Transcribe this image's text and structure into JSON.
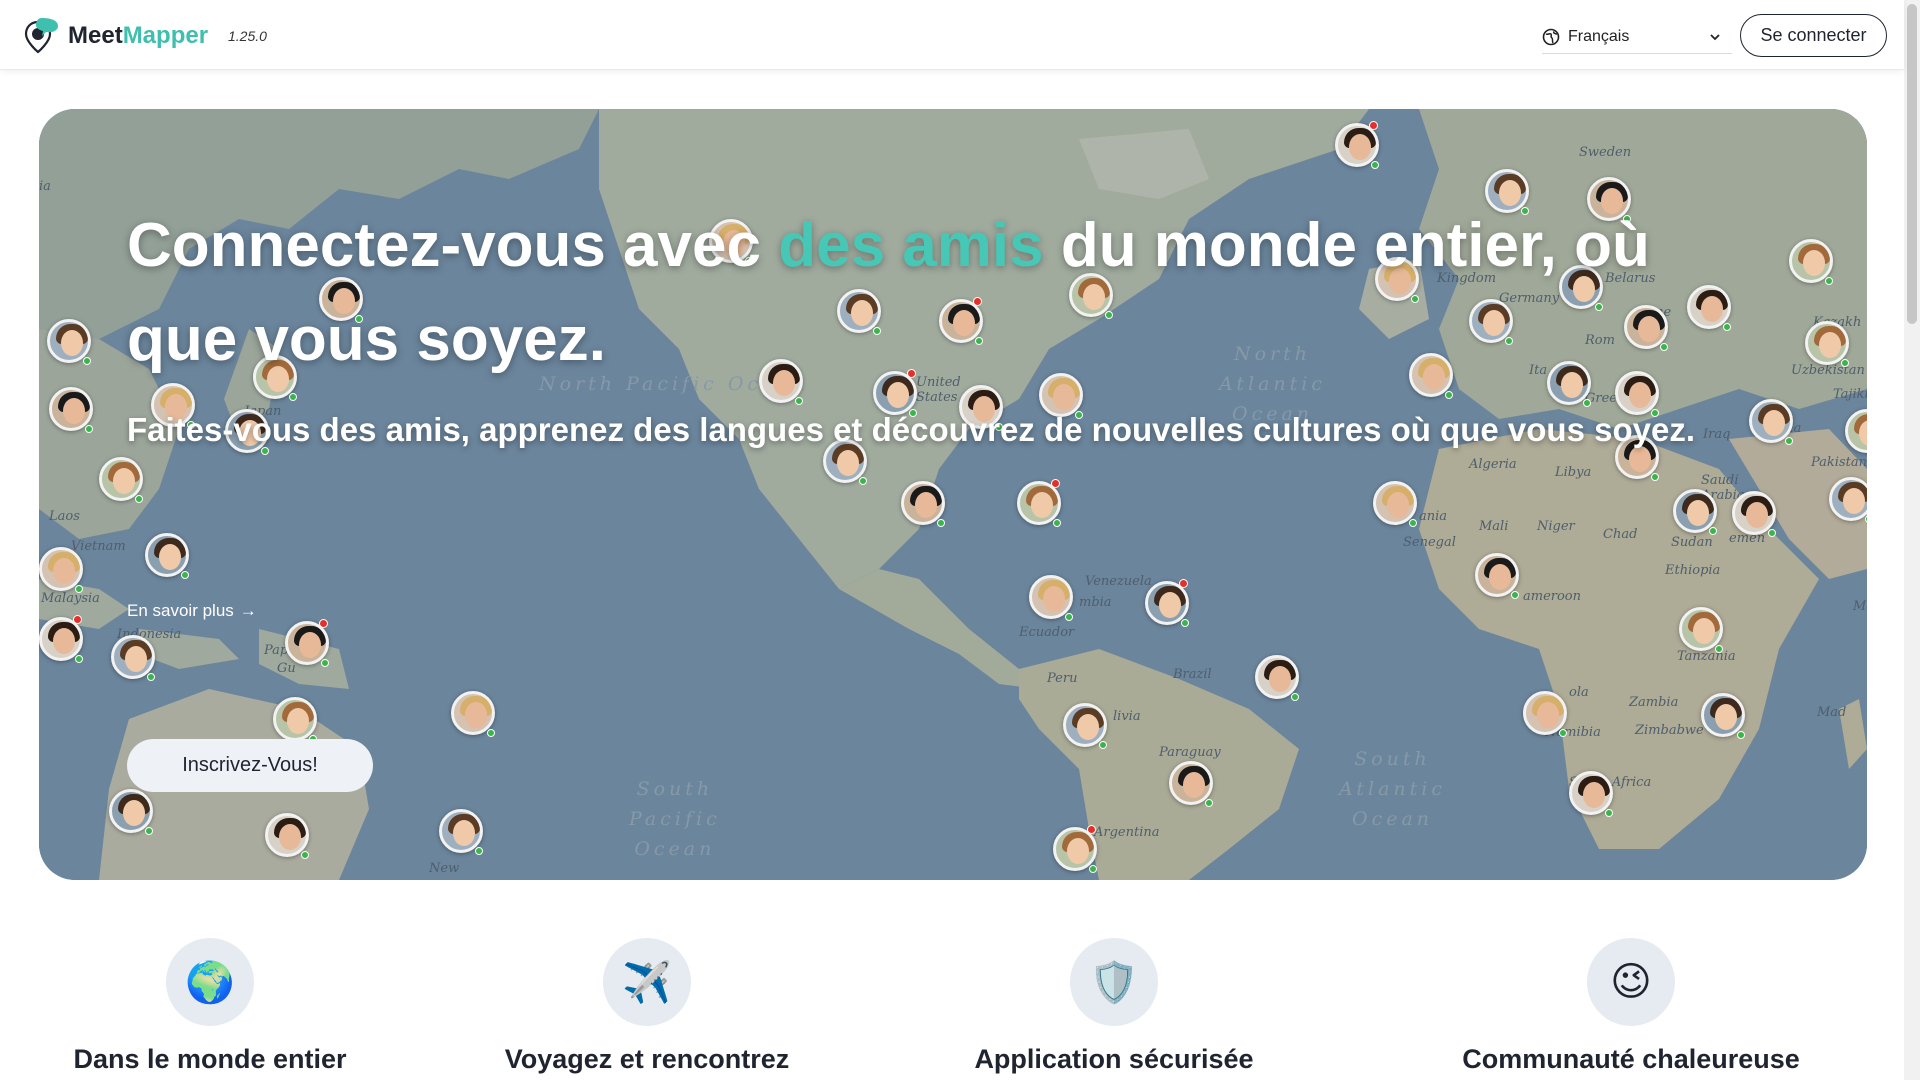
{
  "header": {
    "brand_part1": "Meet",
    "brand_part2": "Mapper",
    "version": "1.25.0",
    "language_selected": "Français",
    "login_label": "Se connecter"
  },
  "hero": {
    "title_before": "Connectez-vous avec ",
    "title_accent": "des amis",
    "title_after": " du monde entier, où que vous soyez.",
    "subtitle": "Faites-vous des amis, apprenez des langues et découvrez de nouvelles cultures où que vous soyez.",
    "learn_more_label": "En savoir plus",
    "signup_label": "Inscrivez-Vous!",
    "accent_color": "#47c7b6"
  },
  "map_labels": {
    "north_pacific": "North Pacific Ocean",
    "north_atlantic_1": "North",
    "north_atlantic_2": "Atlantic",
    "north_atlantic_3": "Ocean",
    "south_pacific_1": "South",
    "south_pacific_2": "Pacific",
    "south_pacific_3": "Ocean",
    "south_atlantic_1": "South",
    "south_atlantic_2": "Atlantic",
    "south_atlantic_3": "Ocean",
    "japan": "Japan",
    "laos": "Laos",
    "vietnam": "Vietnam",
    "malaysia": "Malaysia",
    "indonesia": "Indonesia",
    "papua": "Pap",
    "guinea": "Gu",
    "new": "New",
    "united_states_1": "United",
    "united_states_2": "States",
    "venezuela": "Venezuela",
    "colombia": "mbia",
    "ecuador": "Ecuador",
    "peru": "Peru",
    "brazil": "Brazil",
    "bolivia": "livia",
    "paraguay": "Paraguay",
    "argentina": "Argentina",
    "sweden": "Sweden",
    "kingdom": "Kingdom",
    "germany": "Germany",
    "belarus": "Belarus",
    "ukraine": "ine",
    "romania": "Rom",
    "italy": "Ita",
    "greece": "Greece",
    "algeria": "Algeria",
    "libya": "Libya",
    "mauritania": "ania",
    "mali": "Mali",
    "niger": "Niger",
    "chad": "Chad",
    "sudan": "Sudan",
    "senegal": "Senegal",
    "ethiopia": "Ethiopia",
    "cameroon": "ameroon",
    "tanzania": "Tanzania",
    "angola": "ola",
    "zambia": "Zambia",
    "namibia": "Namibia",
    "zimbabwe": "Zimbabwe",
    "south_africa": "South Africa",
    "madagascar": "Mad",
    "iraq": "Iraq",
    "saudi_1": "Saudi",
    "saudi_2": "Arabia",
    "yemen": "emen",
    "afghanistan": "Afgha",
    "pakistan": "Pakistan",
    "uzbekistan": "Uzbekistan",
    "kazakhstan": "Kazakh",
    "tajikistan": "Tajiki",
    "somalia": "Ma",
    "russia_edge": "ia"
  },
  "features": [
    {
      "icon": "🌍",
      "title": "Dans le monde entier"
    },
    {
      "icon": "✈️",
      "title": "Voyagez et rencontrez"
    },
    {
      "icon": "🛡️",
      "title": "Application sécurisée"
    },
    {
      "icon": "😉",
      "title": "Communauté chaleureuse"
    }
  ]
}
